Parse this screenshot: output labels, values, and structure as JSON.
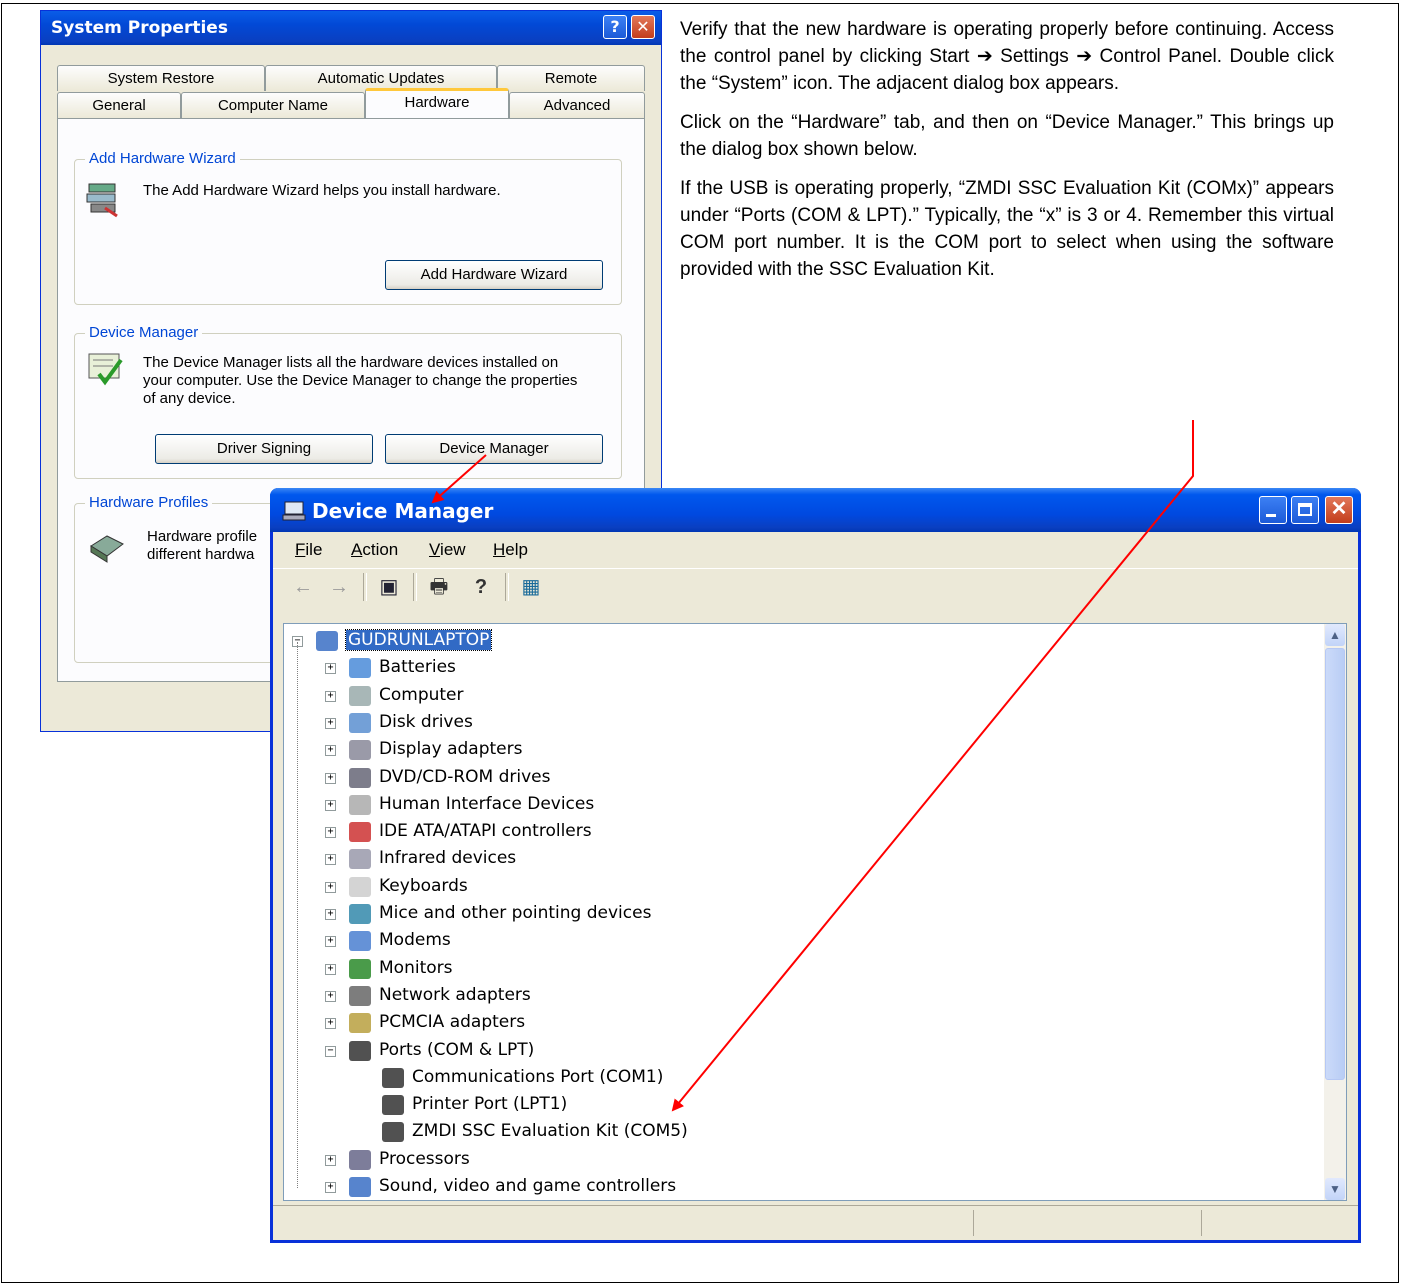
{
  "system_properties": {
    "title": "System Properties",
    "help_glyph": "?",
    "close_glyph": "✕",
    "tabs_row1": [
      "System Restore",
      "Automatic Updates",
      "Remote"
    ],
    "tabs_row2": [
      "General",
      "Computer Name",
      "Hardware",
      "Advanced"
    ],
    "selected_tab": "Hardware",
    "add_hardware": {
      "group_title": "Add Hardware Wizard",
      "text": "The Add Hardware Wizard helps you install hardware.",
      "button": "Add Hardware Wizard"
    },
    "device_manager": {
      "group_title": "Device Manager",
      "text": "The Device Manager lists all the hardware devices installed on your computer. Use the Device Manager to change the properties of any device.",
      "button_driver_signing": "Driver Signing",
      "button_device_manager": "Device Manager"
    },
    "hardware_profiles": {
      "group_title": "Hardware Profiles",
      "text": "Hardware profile different hardwa"
    }
  },
  "instructions": [
    "Verify that the new hardware is operating properly before continuing. Access the control panel by clicking Start ➔ Settings ➔ Control Panel. Double click the “System” icon. The adjacent dialog box appears.",
    "Click on the “Hardware” tab, and then on “Device Manager.” This brings up the dialog box shown below.",
    "If the USB is operating properly, “ZMDI SSC Evaluation Kit (COMx)” appears under “Ports (COM & LPT).” Typically, the “x” is 3 or 4. Remember this virtual COM port number. It is the COM port to select when using the software provided with the SSC Evaluation Kit."
  ],
  "device_manager_window": {
    "title": "Device Manager",
    "menu": [
      {
        "u": "F",
        "rest": "ile"
      },
      {
        "u": "A",
        "rest": "ction"
      },
      {
        "u": "V",
        "rest": "iew"
      },
      {
        "u": "H",
        "rest": "elp"
      }
    ],
    "toolbar": {
      "back": "←",
      "forward": "→",
      "properties": "▣",
      "print": "🖶",
      "help": "?",
      "scan": "▦"
    },
    "tree": {
      "root": "GUDRUNLAPTOP",
      "categories": [
        "Batteries",
        "Computer",
        "Disk drives",
        "Display adapters",
        "DVD/CD-ROM drives",
        "Human Interface Devices",
        "IDE ATA/ATAPI controllers",
        "Infrared devices",
        "Keyboards",
        "Mice and other pointing devices",
        "Modems",
        "Monitors",
        "Network adapters",
        "PCMCIA adapters",
        "Ports (COM & LPT)"
      ],
      "ports_children": [
        "Communications Port (COM1)",
        "Printer Port (LPT1)",
        "ZMDI SSC Evaluation Kit (COM5)"
      ],
      "after_ports": [
        "Processors",
        "Sound, video and game controllers"
      ]
    },
    "scroll_up": "▲",
    "scroll_down": "▼",
    "close_glyph": "✕",
    "expand_plus": "+",
    "expand_minus": "−"
  },
  "colors": {
    "xp_blue": "#0a5de8",
    "selection": "#316ac5",
    "arrow": "#ff0000",
    "group_title": "#0046d5"
  }
}
